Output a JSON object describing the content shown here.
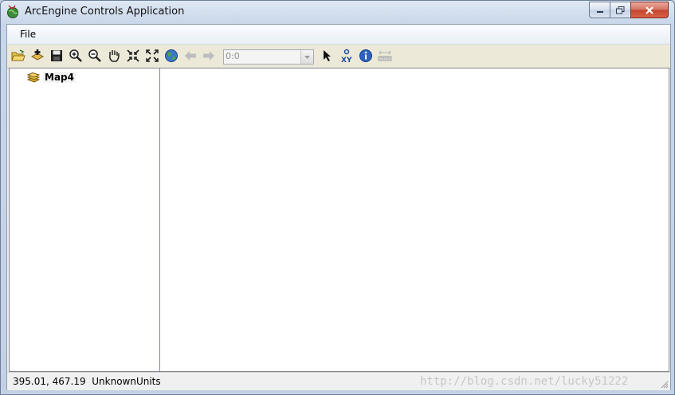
{
  "window": {
    "title": "ArcEngine Controls Application"
  },
  "menu": {
    "file": "File"
  },
  "toolbar": {
    "tools": [
      "open-document",
      "add-data",
      "save",
      "zoom-in",
      "zoom-out",
      "pan",
      "fixed-zoom-in",
      "full-extent",
      "globe",
      "back",
      "forward",
      "select",
      "xy",
      "identify",
      "measure"
    ],
    "scale_value": "0:0"
  },
  "toc": {
    "layer_name": "Map4"
  },
  "status": {
    "coordinates": "395.01, 467.19",
    "units": "UnknownUnits",
    "watermark": "http://blog.csdn.net/lucky51222"
  },
  "colors": {
    "toolbar_bg": "#ece9d8",
    "accent_blue": "#2255aa",
    "close_red": "#c4432d"
  }
}
